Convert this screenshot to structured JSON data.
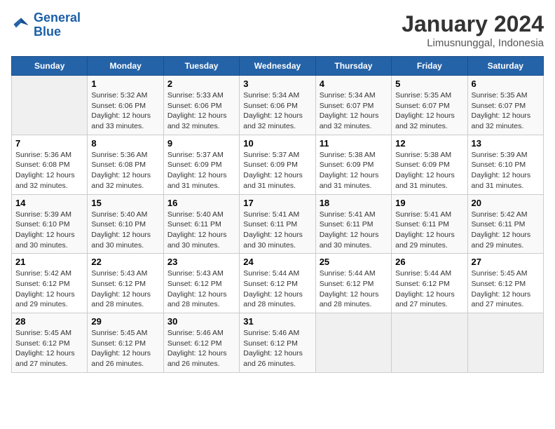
{
  "header": {
    "logo_line1": "General",
    "logo_line2": "Blue",
    "month_year": "January 2024",
    "location": "Limusnunggal, Indonesia"
  },
  "weekdays": [
    "Sunday",
    "Monday",
    "Tuesday",
    "Wednesday",
    "Thursday",
    "Friday",
    "Saturday"
  ],
  "weeks": [
    [
      {
        "day": "",
        "info": ""
      },
      {
        "day": "1",
        "info": "Sunrise: 5:32 AM\nSunset: 6:06 PM\nDaylight: 12 hours\nand 33 minutes."
      },
      {
        "day": "2",
        "info": "Sunrise: 5:33 AM\nSunset: 6:06 PM\nDaylight: 12 hours\nand 32 minutes."
      },
      {
        "day": "3",
        "info": "Sunrise: 5:34 AM\nSunset: 6:06 PM\nDaylight: 12 hours\nand 32 minutes."
      },
      {
        "day": "4",
        "info": "Sunrise: 5:34 AM\nSunset: 6:07 PM\nDaylight: 12 hours\nand 32 minutes."
      },
      {
        "day": "5",
        "info": "Sunrise: 5:35 AM\nSunset: 6:07 PM\nDaylight: 12 hours\nand 32 minutes."
      },
      {
        "day": "6",
        "info": "Sunrise: 5:35 AM\nSunset: 6:07 PM\nDaylight: 12 hours\nand 32 minutes."
      }
    ],
    [
      {
        "day": "7",
        "info": "Sunrise: 5:36 AM\nSunset: 6:08 PM\nDaylight: 12 hours\nand 32 minutes."
      },
      {
        "day": "8",
        "info": "Sunrise: 5:36 AM\nSunset: 6:08 PM\nDaylight: 12 hours\nand 32 minutes."
      },
      {
        "day": "9",
        "info": "Sunrise: 5:37 AM\nSunset: 6:09 PM\nDaylight: 12 hours\nand 31 minutes."
      },
      {
        "day": "10",
        "info": "Sunrise: 5:37 AM\nSunset: 6:09 PM\nDaylight: 12 hours\nand 31 minutes."
      },
      {
        "day": "11",
        "info": "Sunrise: 5:38 AM\nSunset: 6:09 PM\nDaylight: 12 hours\nand 31 minutes."
      },
      {
        "day": "12",
        "info": "Sunrise: 5:38 AM\nSunset: 6:09 PM\nDaylight: 12 hours\nand 31 minutes."
      },
      {
        "day": "13",
        "info": "Sunrise: 5:39 AM\nSunset: 6:10 PM\nDaylight: 12 hours\nand 31 minutes."
      }
    ],
    [
      {
        "day": "14",
        "info": "Sunrise: 5:39 AM\nSunset: 6:10 PM\nDaylight: 12 hours\nand 30 minutes."
      },
      {
        "day": "15",
        "info": "Sunrise: 5:40 AM\nSunset: 6:10 PM\nDaylight: 12 hours\nand 30 minutes."
      },
      {
        "day": "16",
        "info": "Sunrise: 5:40 AM\nSunset: 6:11 PM\nDaylight: 12 hours\nand 30 minutes."
      },
      {
        "day": "17",
        "info": "Sunrise: 5:41 AM\nSunset: 6:11 PM\nDaylight: 12 hours\nand 30 minutes."
      },
      {
        "day": "18",
        "info": "Sunrise: 5:41 AM\nSunset: 6:11 PM\nDaylight: 12 hours\nand 30 minutes."
      },
      {
        "day": "19",
        "info": "Sunrise: 5:41 AM\nSunset: 6:11 PM\nDaylight: 12 hours\nand 29 minutes."
      },
      {
        "day": "20",
        "info": "Sunrise: 5:42 AM\nSunset: 6:11 PM\nDaylight: 12 hours\nand 29 minutes."
      }
    ],
    [
      {
        "day": "21",
        "info": "Sunrise: 5:42 AM\nSunset: 6:12 PM\nDaylight: 12 hours\nand 29 minutes."
      },
      {
        "day": "22",
        "info": "Sunrise: 5:43 AM\nSunset: 6:12 PM\nDaylight: 12 hours\nand 28 minutes."
      },
      {
        "day": "23",
        "info": "Sunrise: 5:43 AM\nSunset: 6:12 PM\nDaylight: 12 hours\nand 28 minutes."
      },
      {
        "day": "24",
        "info": "Sunrise: 5:44 AM\nSunset: 6:12 PM\nDaylight: 12 hours\nand 28 minutes."
      },
      {
        "day": "25",
        "info": "Sunrise: 5:44 AM\nSunset: 6:12 PM\nDaylight: 12 hours\nand 28 minutes."
      },
      {
        "day": "26",
        "info": "Sunrise: 5:44 AM\nSunset: 6:12 PM\nDaylight: 12 hours\nand 27 minutes."
      },
      {
        "day": "27",
        "info": "Sunrise: 5:45 AM\nSunset: 6:12 PM\nDaylight: 12 hours\nand 27 minutes."
      }
    ],
    [
      {
        "day": "28",
        "info": "Sunrise: 5:45 AM\nSunset: 6:12 PM\nDaylight: 12 hours\nand 27 minutes."
      },
      {
        "day": "29",
        "info": "Sunrise: 5:45 AM\nSunset: 6:12 PM\nDaylight: 12 hours\nand 26 minutes."
      },
      {
        "day": "30",
        "info": "Sunrise: 5:46 AM\nSunset: 6:12 PM\nDaylight: 12 hours\nand 26 minutes."
      },
      {
        "day": "31",
        "info": "Sunrise: 5:46 AM\nSunset: 6:12 PM\nDaylight: 12 hours\nand 26 minutes."
      },
      {
        "day": "",
        "info": ""
      },
      {
        "day": "",
        "info": ""
      },
      {
        "day": "",
        "info": ""
      }
    ]
  ]
}
